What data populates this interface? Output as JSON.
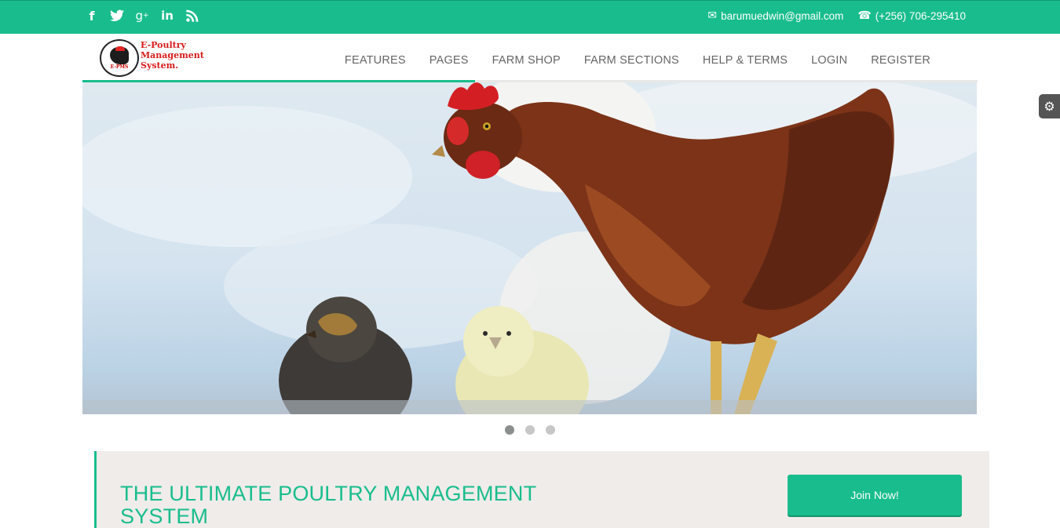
{
  "topbar": {
    "social": [
      "facebook-icon",
      "twitter-icon",
      "google-plus-icon",
      "linkedin-icon",
      "rss-icon"
    ],
    "email": "barumuedwin@gmail.com",
    "phone": "(+256) 706-295410"
  },
  "brand": {
    "line1": "E-Poultry",
    "line2": "Management",
    "line3": "System.",
    "logo_tag": "E-PMS"
  },
  "nav": {
    "items": [
      "FEATURES",
      "PAGES",
      "FARM SHOP",
      "FARM SECTIONS",
      "HELP & TERMS",
      "LOGIN",
      "REGISTER"
    ]
  },
  "slider": {
    "slides": 3,
    "active": 1
  },
  "cta": {
    "title": "THE ULTIMATE POULTRY MANAGEMENT SYSTEM",
    "button": "Join Now!"
  },
  "colors": {
    "accent": "#19bd8d",
    "brand_red": "#d81b1b",
    "cta_bg": "#efecea"
  }
}
